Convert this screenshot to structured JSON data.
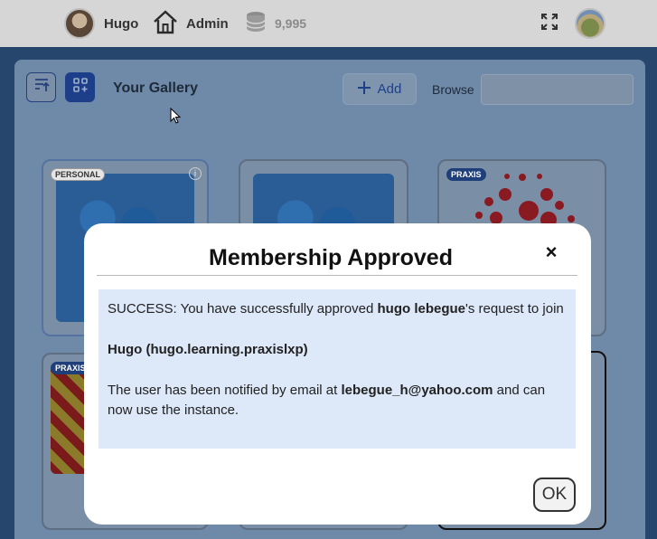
{
  "topbar": {
    "user_name": "Hugo",
    "admin_label": "Admin",
    "coins": "9,995"
  },
  "gallery": {
    "title": "Your Gallery",
    "add_label": "Add",
    "browse_label": "Browse",
    "browse_value": "",
    "cards": [
      {
        "badge": "PERSONAL"
      },
      {
        "badge": ""
      },
      {
        "badge": "PRAXIS"
      },
      {
        "badge": "PRAXIS"
      }
    ]
  },
  "modal": {
    "title": "Membership Approved",
    "close_symbol": "×",
    "line1_prefix": "SUCCESS: You have successfully approved ",
    "requester_name": "hugo lebegue",
    "line1_suffix": "'s request to join",
    "instance_name": "Hugo (hugo.learning.praxislxp)",
    "line3_prefix": "The user has been notified by email at ",
    "email": "lebegue_h@yahoo.com",
    "line3_suffix": " and can now use the instance.",
    "ok_label": "OK"
  },
  "colors": {
    "accent_blue": "#1d3f8a",
    "message_bg": "#dde8f8",
    "praxis_red": "#c1121f"
  },
  "icons": [
    "user-avatar",
    "home-icon",
    "coins-stack-icon",
    "fullscreen-icon",
    "profile-avatar",
    "sort-icon",
    "grid-add-icon",
    "plus-icon",
    "close-icon",
    "info-icon"
  ]
}
